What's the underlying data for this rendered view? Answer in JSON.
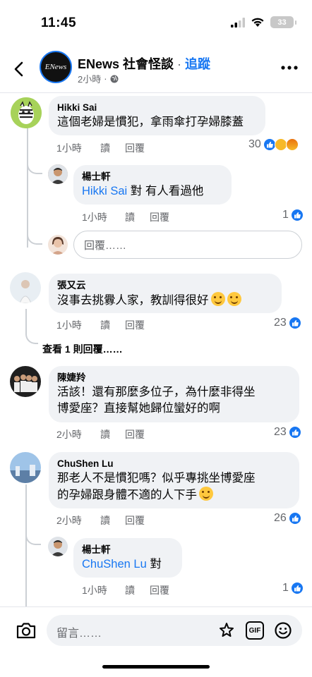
{
  "status_bar": {
    "time": "11:45",
    "battery": "33"
  },
  "header": {
    "page_name": "ENews 社會怪談",
    "separator": " · ",
    "follow_label": "追蹤",
    "logo_text": "ENews",
    "post_time": "2小時",
    "icons": {
      "back": "chevron-left-icon",
      "privacy": "globe-icon",
      "more": "more-horizontal-icon"
    }
  },
  "comments": [
    {
      "author": "Hikki Sai",
      "text": "這個老婦是慣犯，拿雨傘打孕婦膝蓋",
      "time": "1小時",
      "read": "讀",
      "reply": "回覆",
      "reaction_count": "30",
      "reactions": [
        "like",
        "wow",
        "angry"
      ],
      "replies": [
        {
          "author": "楊士軒",
          "mention": "Hikki Sai",
          "text": " 對 有人看過他",
          "time": "1小時",
          "read": "讀",
          "reply": "回覆",
          "reaction_count": "1"
        }
      ],
      "reply_placeholder": "回覆……"
    },
    {
      "author": "張又云",
      "text": "沒事去挑釁人家，教訓得很好",
      "emojis": [
        "rofl-emoji",
        "rofl-emoji"
      ],
      "time": "1小時",
      "read": "讀",
      "reply": "回覆",
      "reaction_count": "23",
      "view_replies": "查看 1 則回覆……"
    },
    {
      "author": "陳婕羚",
      "text_lines": [
        "活該！還有那麼多位子，為什麼非得坐",
        "博愛座？直接幫她歸位蠻好的啊"
      ],
      "time": "2小時",
      "read": "讀",
      "reply": "回覆",
      "reaction_count": "23"
    },
    {
      "author": "ChuShen Lu",
      "text_lines": [
        "那老人不是慣犯嗎？似乎專挑坐博愛座",
        "的孕婦跟身體不適的人下手"
      ],
      "emojis": [
        "thinking-emoji"
      ],
      "time": "2小時",
      "read": "讀",
      "reply": "回覆",
      "reaction_count": "26",
      "replies": [
        {
          "author": "楊士軒",
          "mention": "ChuShen Lu",
          "text": " 對",
          "time": "1小時",
          "read": "讀",
          "reply": "回覆",
          "reaction_count": "1"
        }
      ]
    }
  ],
  "composer": {
    "placeholder": "留言……",
    "icons": [
      "camera-icon",
      "sticker-icon",
      "gif-icon",
      "emoji-icon"
    ],
    "gif_label": "GIF"
  },
  "colors": {
    "accent": "#1877f2",
    "bubble": "#f0f2f5",
    "muted": "#65676b"
  }
}
